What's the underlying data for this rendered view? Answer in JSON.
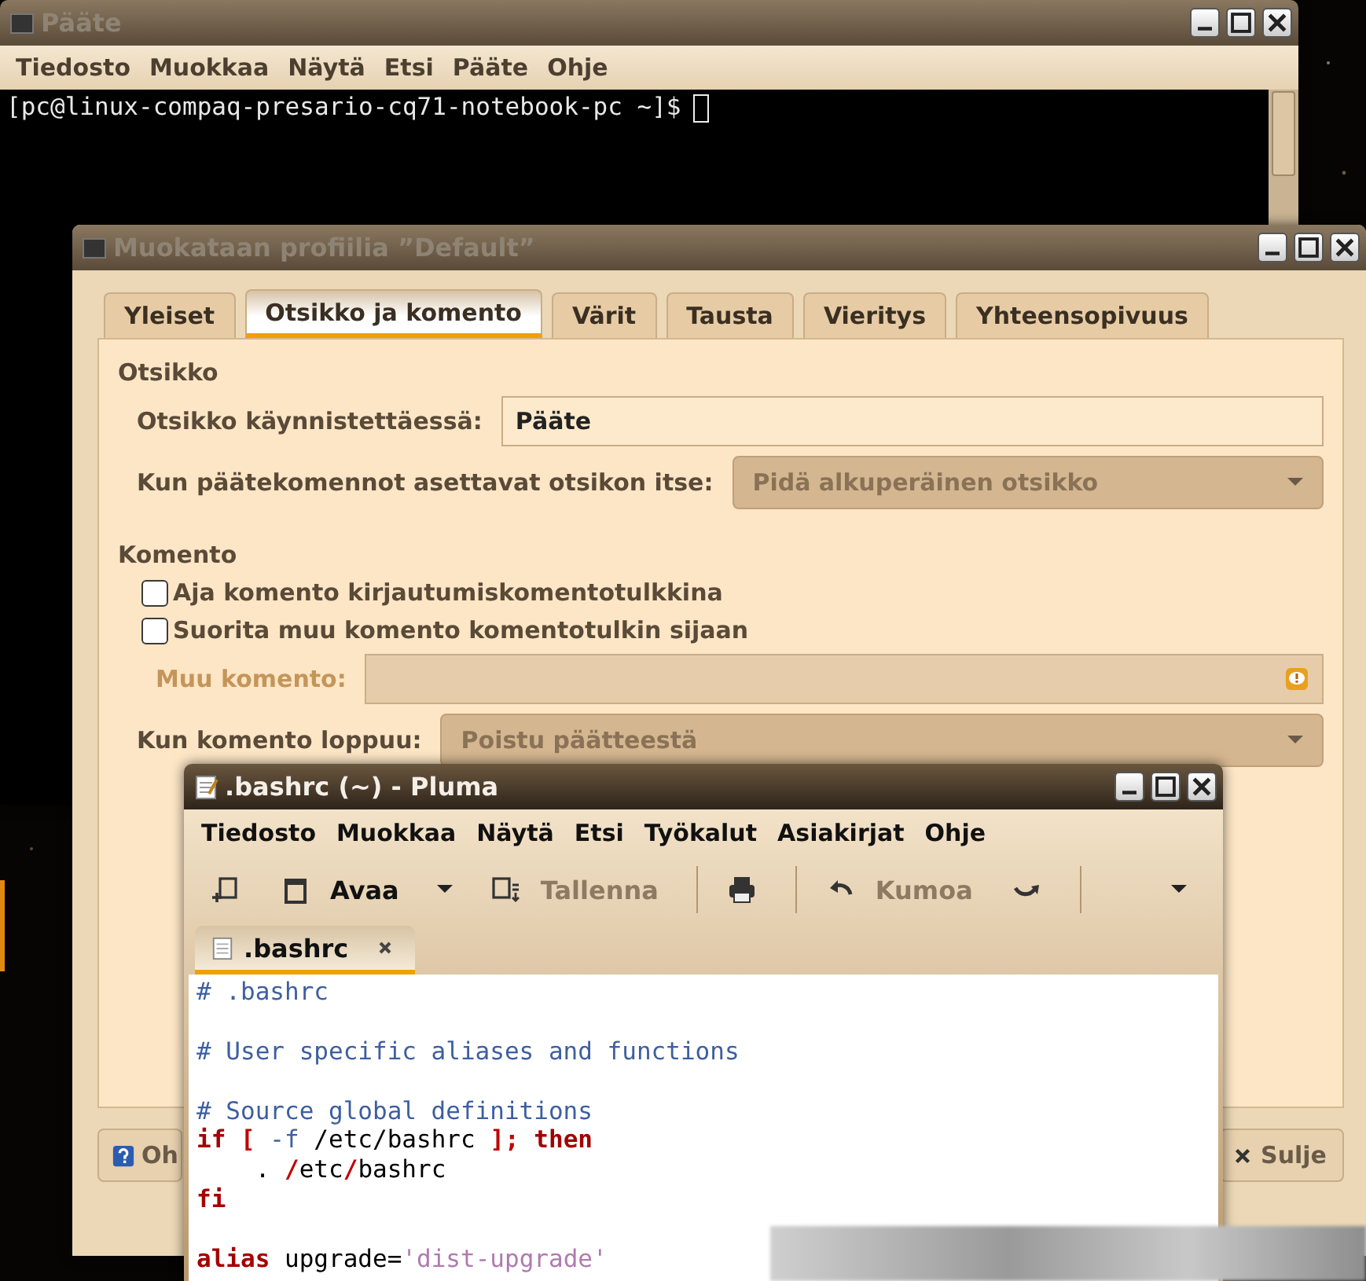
{
  "terminal": {
    "title": "Pääte",
    "active": false,
    "menu": [
      "Tiedosto",
      "Muokkaa",
      "Näytä",
      "Etsi",
      "Pääte",
      "Ohje"
    ],
    "prompt": "[pc@linux-compaq-presario-cq71-notebook-pc ~]$"
  },
  "profile_dialog": {
    "title": "Muokataan profiilia ”Default”",
    "active": false,
    "tabs": [
      {
        "label": "Yleiset",
        "selected": false
      },
      {
        "label": "Otsikko ja komento",
        "selected": true
      },
      {
        "label": "Värit",
        "selected": false
      },
      {
        "label": "Tausta",
        "selected": false
      },
      {
        "label": "Vieritys",
        "selected": false
      },
      {
        "label": "Yhteensopivuus",
        "selected": false
      }
    ],
    "title_section": {
      "heading": "Otsikko",
      "initial_title_label": "Otsikko käynnistettäessä:",
      "initial_title_value": "Pääte",
      "dynamic_title_label": "Kun päätekomennot asettavat otsikon itse:",
      "dynamic_title_value": "Pidä alkuperäinen otsikko"
    },
    "command_section": {
      "heading": "Komento",
      "checkboxes": [
        {
          "label": "Aja komento kirjautumiskomentotulkkina",
          "checked": false
        },
        {
          "label": "Suorita muu komento komentotulkin sijaan",
          "checked": false
        }
      ],
      "custom_command_label": "Muu komento:",
      "custom_command_disabled": true,
      "exit_label": "Kun komento loppuu:",
      "exit_value": "Poistu päätteestä"
    },
    "buttons": [
      {
        "label": "Oh",
        "kind": "help"
      },
      {
        "label": "Sulje",
        "kind": "close"
      }
    ]
  },
  "editor": {
    "title": ".bashrc (~) - Pluma",
    "active": true,
    "menu": [
      "Tiedosto",
      "Muokkaa",
      "Näytä",
      "Etsi",
      "Työkalut",
      "Asiakirjat",
      "Ohje"
    ],
    "toolbar": [
      {
        "kind": "new"
      },
      {
        "kind": "open",
        "label": "Avaa",
        "disabled": false
      },
      {
        "kind": "dropdown"
      },
      {
        "kind": "save",
        "label": "Tallenna",
        "disabled": true
      },
      {
        "kind": "separator"
      },
      {
        "kind": "print"
      },
      {
        "kind": "separator"
      },
      {
        "kind": "undo",
        "label": "Kumoa",
        "disabled": true
      },
      {
        "kind": "redo"
      },
      {
        "kind": "separator"
      },
      {
        "kind": "overflow"
      }
    ],
    "tabs": [
      {
        "label": ".bashrc",
        "selected": true
      }
    ],
    "lines": [
      {
        "kind": "code",
        "tokens": [
          {
            "text": "# .bashrc",
            "kind": "comment"
          }
        ]
      },
      {
        "kind": "blank"
      },
      {
        "kind": "code",
        "tokens": [
          {
            "text": "# User specific aliases and functions",
            "kind": "comment"
          }
        ]
      },
      {
        "kind": "blank"
      },
      {
        "kind": "code",
        "tokens": [
          {
            "text": "# Source global definitions",
            "kind": "comment"
          }
        ]
      },
      {
        "kind": "code",
        "tokens": [
          {
            "text": "if",
            "kind": "keyword"
          },
          {
            "text": " [",
            "kind": "operator"
          },
          {
            "text": " -f",
            "kind": "option"
          },
          {
            "text": " /etc/bashrc ",
            "kind": "plain"
          },
          {
            "text": "];",
            "kind": "operator"
          },
          {
            "text": " then",
            "kind": "keyword"
          }
        ]
      },
      {
        "kind": "code",
        "tokens": [
          {
            "text": "    . ",
            "kind": "plain"
          },
          {
            "text": "/",
            "kind": "operator"
          },
          {
            "text": "etc",
            "kind": "plain"
          },
          {
            "text": "/",
            "kind": "operator"
          },
          {
            "text": "bashrc",
            "kind": "plain"
          }
        ]
      },
      {
        "kind": "code",
        "tokens": [
          {
            "text": "fi",
            "kind": "keyword"
          }
        ]
      },
      {
        "kind": "blank"
      },
      {
        "kind": "code",
        "tokens": [
          {
            "text": "alias",
            "kind": "keyword"
          },
          {
            "text": " upgrade=",
            "kind": "plain"
          },
          {
            "text": "'dist-upgrade'",
            "kind": "string"
          }
        ]
      }
    ]
  }
}
